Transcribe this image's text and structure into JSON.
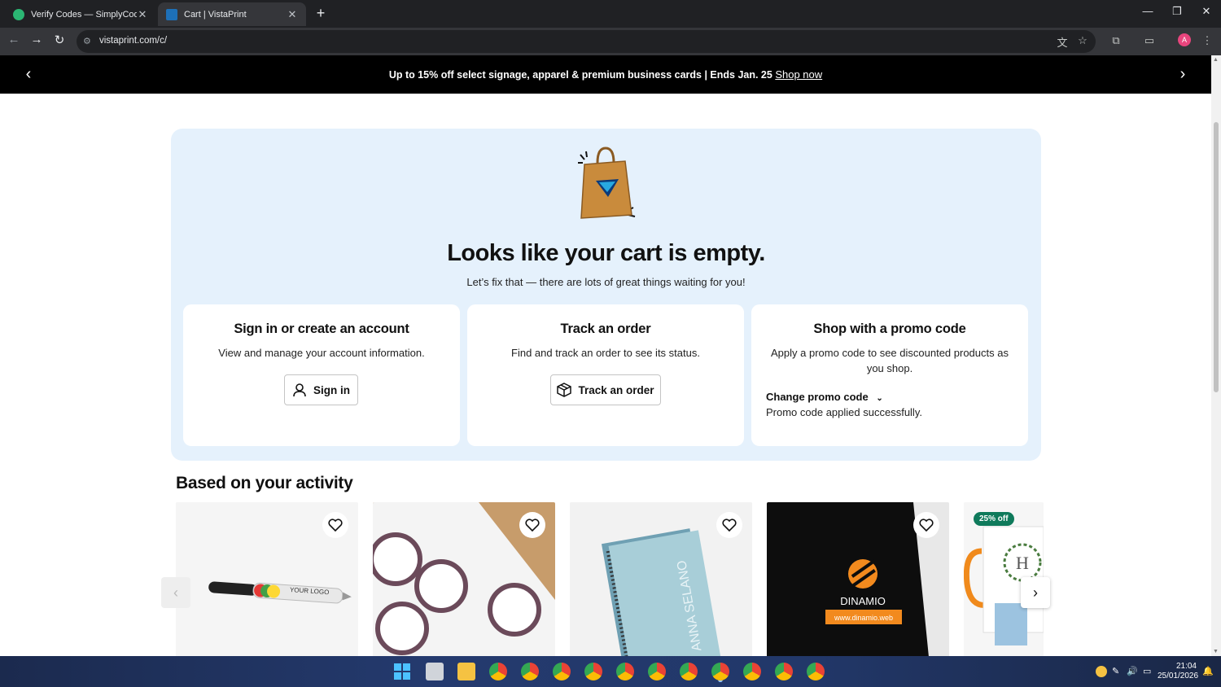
{
  "browser": {
    "tabs": [
      {
        "title": "Verify Codes — SimplyCodes",
        "active": false,
        "favicon_color": "#2bb673"
      },
      {
        "title": "Cart | VistaPrint",
        "active": true,
        "favicon_color": "#1d70b8"
      }
    ],
    "url": "vistaprint.com/c/",
    "profile_initial": "A"
  },
  "promo_bar": {
    "text": "Up to 15% off select signage, apparel & premium business cards | Ends Jan. 25",
    "link": "Shop now"
  },
  "hero": {
    "title": "Looks like your cart is empty.",
    "subtitle": "Let’s fix that — there are lots of great things waiting for you!"
  },
  "cards": {
    "signin": {
      "title": "Sign in or create an account",
      "desc": "View and manage your account information.",
      "button": "Sign in"
    },
    "track": {
      "title": "Track an order",
      "desc": "Find and track an order to see its status.",
      "button": "Track an order"
    },
    "promo": {
      "title": "Shop with a promo code",
      "desc": "Apply a promo code to see discounted products as you shop.",
      "toggle": "Change promo code",
      "status": "Promo code applied successfully."
    }
  },
  "activity": {
    "title": "Based on your activity",
    "products": [
      {
        "name": "pen",
        "badge": ""
      },
      {
        "name": "round-stickers",
        "badge": ""
      },
      {
        "name": "notebook",
        "badge": ""
      },
      {
        "name": "window-decal",
        "badge": ""
      },
      {
        "name": "mug",
        "badge": "25% off"
      }
    ],
    "product_texts": {
      "pen_logo": "YOUR LOGO",
      "notebook_name": "ANNA SELANO",
      "decal_brand": "DINAMIO",
      "decal_url": "www.dinamio.web",
      "mug_letter": "H"
    }
  },
  "taskbar": {
    "time": "21:04",
    "date": "25/01/2026"
  },
  "colors": {
    "hero_bg": "#e5f1fc",
    "promo_bar_bg": "#000000",
    "badge_bg": "#0f7a5b"
  }
}
